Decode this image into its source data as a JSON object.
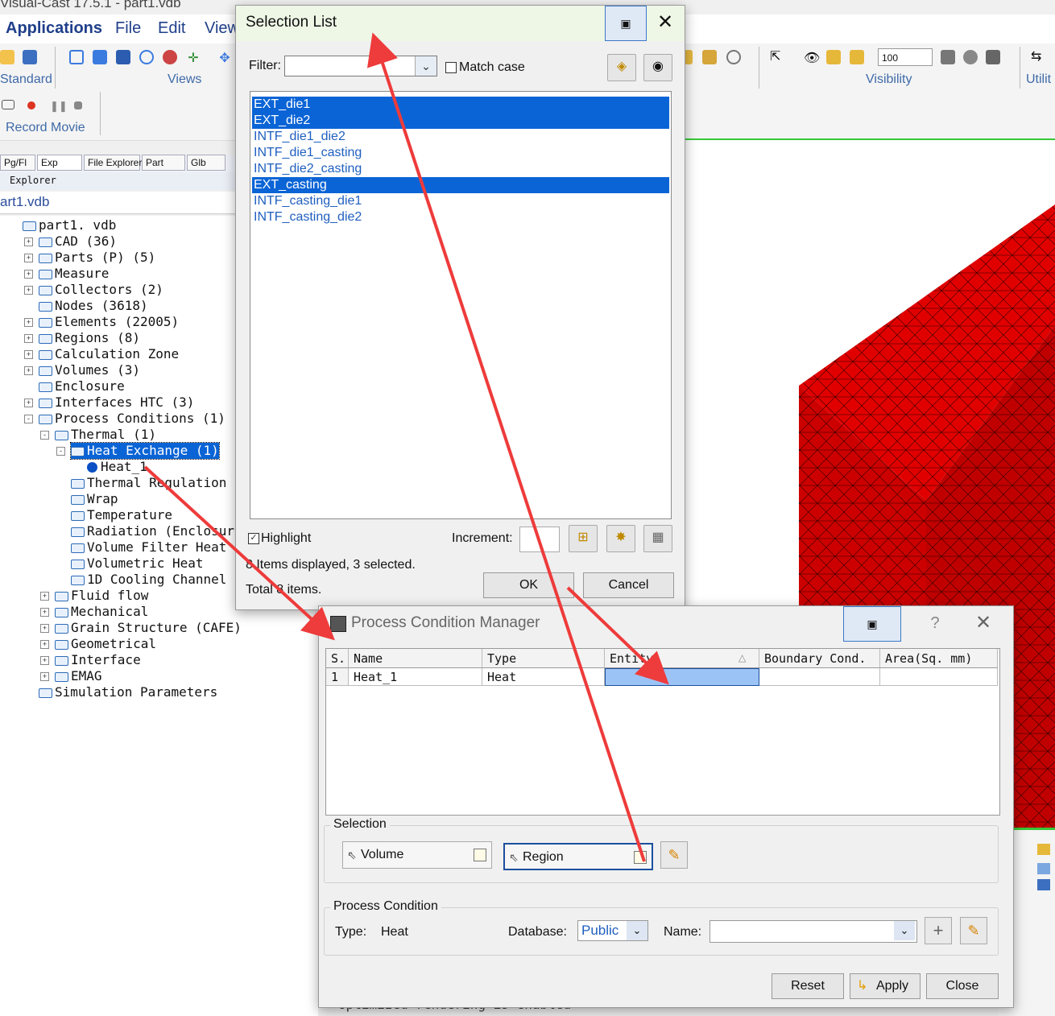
{
  "app": {
    "title": "Visual-Cast 17.5.1 - part1.vdb",
    "menu": [
      "Applications",
      "File",
      "Edit",
      "View"
    ],
    "ribbon_groups": {
      "standard": "Standard",
      "views": "Views",
      "visibility": "Visibility",
      "utilities": "Utilit",
      "record_movie": "Record Movie"
    },
    "visibility_value": "100"
  },
  "left_tabs": [
    "Pg/Fl",
    "Exp",
    "File Explorer",
    "Part",
    "Glb"
  ],
  "explorer": {
    "header": "Explorer",
    "file": "art1.vdb",
    "tree": [
      {
        "label": "part1. vdb"
      },
      {
        "label": "CAD  (36)"
      },
      {
        "label": "Parts  (P)  (5)"
      },
      {
        "label": "Measure"
      },
      {
        "label": "Collectors  (2)"
      },
      {
        "label": "Nodes  (3618)"
      },
      {
        "label": "Elements  (22005)"
      },
      {
        "label": "Regions  (8)"
      },
      {
        "label": "Calculation Zone"
      },
      {
        "label": "Volumes  (3)"
      },
      {
        "label": "Enclosure"
      },
      {
        "label": "Interfaces HTC  (3)"
      },
      {
        "label": "Process Conditions  (1)"
      },
      {
        "label": "Thermal  (1)"
      },
      {
        "label": "Heat Exchange  (1)"
      },
      {
        "label": "Heat_1"
      },
      {
        "label": "Thermal Regulation"
      },
      {
        "label": "Wrap"
      },
      {
        "label": "Temperature"
      },
      {
        "label": "Radiation (Enclosure)"
      },
      {
        "label": "Volume Filter Heat"
      },
      {
        "label": "Volumetric Heat"
      },
      {
        "label": "1D Cooling Channel"
      },
      {
        "label": "Fluid  flow"
      },
      {
        "label": "Mechanical"
      },
      {
        "label": "Grain Structure (CAFE)"
      },
      {
        "label": "Geometrical"
      },
      {
        "label": "Interface"
      },
      {
        "label": "EMAG"
      },
      {
        "label": "Simulation Parameters"
      }
    ]
  },
  "selection_list": {
    "title": "Selection List",
    "filter_label": "Filter:",
    "filter_value": "",
    "match_case_label": "Match case",
    "match_case_checked": false,
    "items": [
      {
        "label": "EXT_die1",
        "selected": true
      },
      {
        "label": "EXT_die2",
        "selected": true
      },
      {
        "label": "INTF_die1_die2",
        "selected": false
      },
      {
        "label": "INTF_die1_casting",
        "selected": false
      },
      {
        "label": "INTF_die2_casting",
        "selected": false
      },
      {
        "label": "EXT_casting",
        "selected": true
      },
      {
        "label": "INTF_casting_die1",
        "selected": false
      },
      {
        "label": "INTF_casting_die2",
        "selected": false
      }
    ],
    "highlight_label": "Highlight",
    "highlight_checked": true,
    "increment_label": "Increment:",
    "increment_value": "",
    "status_displayed": "8 Items displayed, 3 selected.",
    "status_total": "Total 8 items.",
    "ok_label": "OK",
    "cancel_label": "Cancel"
  },
  "pcm": {
    "title": "Process Condition Manager",
    "help_label": "?",
    "columns": [
      "S.",
      "Name",
      "Type",
      "Entity",
      "Boundary Cond.",
      "Area(Sq. mm)"
    ],
    "rows": [
      {
        "s": "1",
        "name": "Heat_1",
        "type": "Heat",
        "entity": "",
        "boundary": "",
        "area": ""
      }
    ],
    "selection_legend": "Selection",
    "volume_label": "Volume",
    "region_label": "Region",
    "process_legend": "Process Condition",
    "type_label": "Type:",
    "type_value": "Heat",
    "database_label": "Database:",
    "database_value": "Public",
    "name_label": "Name:",
    "name_value": "",
    "reset_label": "Reset",
    "apply_label": "Apply",
    "close_label": "Close"
  },
  "log": {
    "line": "Optimized rendering is enabled"
  },
  "colors": {
    "accent": "#0a64d6",
    "mesh": "#d40000",
    "arrow": "#ee3b3b"
  }
}
